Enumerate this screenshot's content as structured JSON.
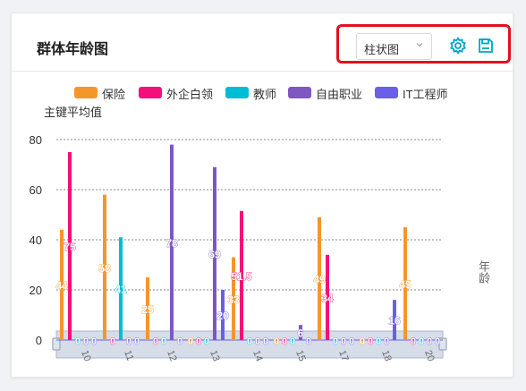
{
  "panel": {
    "title": "群体年龄图",
    "chart_type_select": "柱状图"
  },
  "toolbar": {
    "settings_icon": "gear-icon",
    "save_icon": "save-icon",
    "accent_color": "#00a4c8",
    "highlight_color": "#e01020"
  },
  "chart_data": {
    "type": "bar",
    "title": "",
    "ylabel": "主键平均值",
    "y2label": "年龄",
    "ylim": [
      0,
      80
    ],
    "yticks": [
      0,
      20,
      40,
      60,
      80
    ],
    "categories": [
      "10",
      "11",
      "12",
      "13",
      "14",
      "15",
      "17",
      "18",
      "20"
    ],
    "grid": true,
    "legend_position": "top",
    "series": [
      {
        "name": "保险",
        "color": "#f5962b",
        "values": [
          44,
          58,
          25,
          0,
          33,
          0,
          49,
          0,
          45
        ]
      },
      {
        "name": "外企白领",
        "color": "#f50f7b",
        "values": [
          75,
          0,
          0,
          0,
          51.5,
          0,
          34,
          0,
          0
        ]
      },
      {
        "name": "教师",
        "color": "#00bcd4",
        "values": [
          0,
          41,
          0,
          0,
          0,
          0,
          0,
          0,
          0
        ]
      },
      {
        "name": "自由职业",
        "color": "#7e57c2",
        "values": [
          0,
          0,
          78,
          69,
          0,
          6,
          0,
          0,
          0
        ]
      },
      {
        "name": "IT工程师",
        "color": "#6a5fe8",
        "values": [
          0,
          0,
          0,
          20,
          0,
          0,
          0,
          16,
          0
        ]
      }
    ]
  }
}
